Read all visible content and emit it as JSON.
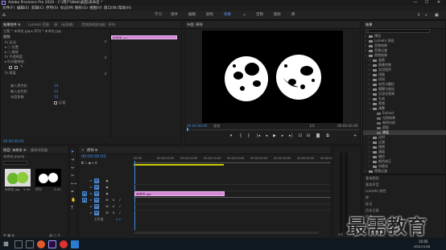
{
  "window": {
    "title": "Adobe Premiere Pro 2020 - C:\\用户\\Web\\桌面\\未命名 *",
    "minimize": "—",
    "maximize": "☐",
    "close": "✕"
  },
  "menu": [
    "文件(F)",
    "编辑(E)",
    "剪辑(C)",
    "序列(S)",
    "标记(M)",
    "图形(G)",
    "视图(V)",
    "窗口(W)",
    "帮助(H)"
  ],
  "workspaces": {
    "items": [
      "学习",
      "组件",
      "编辑",
      "颜色",
      "效果",
      "音频",
      "图形",
      "库"
    ],
    "active_index": 4,
    "more": "»"
  },
  "effect_controls": {
    "tabs": [
      "效果控件 ≡",
      "Lumetri 范围",
      "源：(无剪辑)",
      "音频剪辑混合器：序列"
    ],
    "active_tab": 0,
    "source_line": "主要 * 未命名.jpg  ▸  序列 * 未命名.jpg",
    "section": "视频",
    "rows": [
      "fx 运动",
      "▸ ○ 位置",
      "▸ ○ 缩放",
      "fx 不透明度",
      "▸ 时间重映射"
    ],
    "effect_name": "fx 阈值",
    "params": [
      {
        "name": "输入黑色阶",
        "value": "33"
      },
      {
        "name": "输入白色阶",
        "value": "33"
      },
      {
        "name": "灰度系数",
        "value": "33"
      }
    ],
    "checkbox_label": "反相",
    "timecode": "00:00:00:00",
    "clip_label": "未命名.jpg"
  },
  "program": {
    "tab": "节目: 序列",
    "timecode_left": "00:00:00:00",
    "fit": "适合",
    "fraction": "1/2",
    "timecode_right": "00:00:05:00"
  },
  "effects_panel": {
    "title": "效果",
    "tree": [
      {
        "label": "预设",
        "indent": 0
      },
      {
        "label": "Lumetri 预设",
        "indent": 0
      },
      {
        "label": "音频效果",
        "indent": 0
      },
      {
        "label": "音频过渡",
        "indent": 0
      },
      {
        "label": "视频效果",
        "indent": 0
      },
      {
        "label": "变换",
        "indent": 1
      },
      {
        "label": "图像控制",
        "indent": 1
      },
      {
        "label": "实用程序",
        "indent": 1
      },
      {
        "label": "扭曲",
        "indent": 1
      },
      {
        "label": "时间",
        "indent": 1
      },
      {
        "label": "杂色与颗粒",
        "indent": 1
      },
      {
        "label": "模糊与锐化",
        "indent": 1
      },
      {
        "label": "沉浸式视频",
        "indent": 1
      },
      {
        "label": "生成",
        "indent": 1
      },
      {
        "label": "视频",
        "indent": 1
      },
      {
        "label": "调整",
        "indent": 1
      },
      {
        "label": "Extract",
        "indent": 2
      },
      {
        "label": "光照效果",
        "indent": 2
      },
      {
        "label": "卷积内核",
        "indent": 2
      },
      {
        "label": "提取",
        "indent": 2
      },
      {
        "label": "阈值",
        "indent": 2,
        "selected": true
      },
      {
        "label": "过时",
        "indent": 1
      },
      {
        "label": "过渡",
        "indent": 1
      },
      {
        "label": "透视",
        "indent": 1
      },
      {
        "label": "通道",
        "indent": 1
      },
      {
        "label": "键控",
        "indent": 1
      },
      {
        "label": "颜色校正",
        "indent": 1
      },
      {
        "label": "风格化",
        "indent": 1
      },
      {
        "label": "视频过渡",
        "indent": 0
      }
    ],
    "sub_panels": [
      "基本图形",
      "基本声音",
      "Lumetri 颜色",
      "库",
      "标记",
      "历史记录",
      "信息"
    ]
  },
  "project": {
    "tabs": [
      "项目: 未命名 ≡",
      "媒体浏览器"
    ],
    "active_tab": 0,
    "path": "未命名.prproj",
    "items": [
      {
        "name": "未命名.jpg",
        "duration": "5:00"
      },
      {
        "name": "序列",
        "duration": "5:00"
      }
    ]
  },
  "timeline": {
    "tab": "序列 ≡",
    "timecode": "00:00:00:00",
    "ruler_labels": [
      "00:00",
      "00:00:05:00",
      "00:00:10:00",
      "00:00:15:00",
      "00:00:20:00",
      "00:00:25:00",
      "00:00:30:00",
      "00:00:35:00",
      "00:00:40:00"
    ],
    "video_tracks": [
      "V3",
      "V2",
      "V1"
    ],
    "audio_tracks": [
      "A1",
      "A2",
      "A3"
    ],
    "master_label": "主声道",
    "master_value": "0.0",
    "clip_label": "未命名.jpg"
  },
  "watermark": "最需教育",
  "taskbar": {
    "time": "15:05",
    "date": "2021/11/26"
  },
  "colors": {
    "accent_blue": "#3f8be0",
    "clip_pink": "#d38ad6",
    "ruler_yellow": "#c8c800"
  }
}
